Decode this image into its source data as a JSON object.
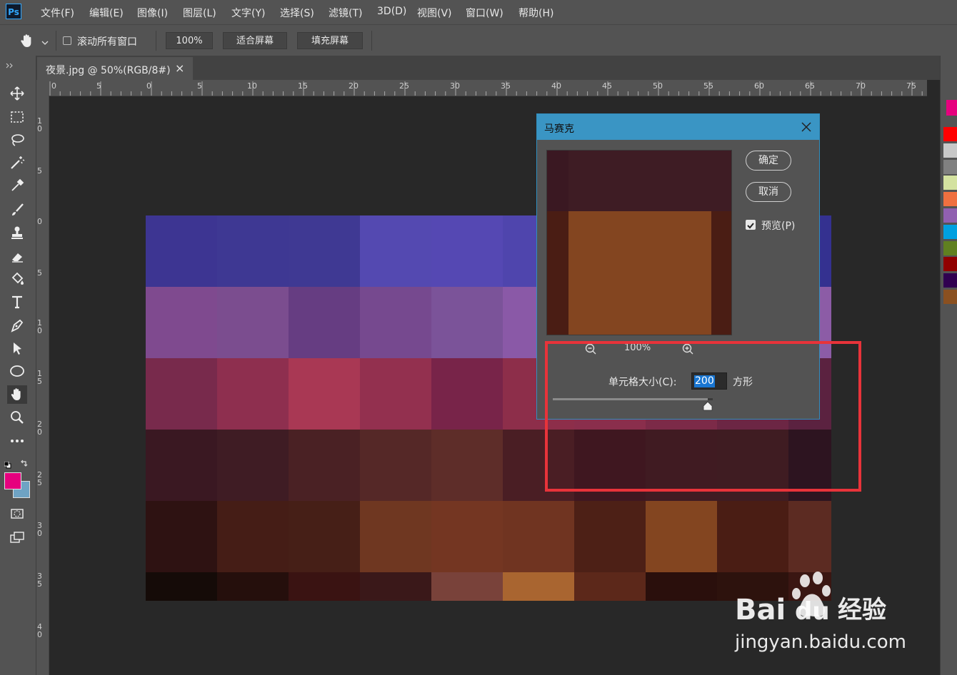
{
  "menu": {
    "logo": "Ps",
    "items": [
      "文件(F)",
      "编辑(E)",
      "图像(I)",
      "图层(L)",
      "文字(Y)",
      "选择(S)",
      "滤镜(T)",
      "3D(D)",
      "视图(V)",
      "窗口(W)",
      "帮助(H)"
    ]
  },
  "options": {
    "scroll_all_label": "滚动所有窗口",
    "zoom_100": "100%",
    "fit_screen": "适合屏幕",
    "fill_screen": "填充屏幕"
  },
  "document": {
    "tab_label": "夜景.jpg @ 50%(RGB/8#)",
    "tab_close": "×"
  },
  "ruler": {
    "h_labels": [
      "0",
      "5",
      "0",
      "5",
      "10",
      "15",
      "20",
      "25",
      "30",
      "35",
      "40",
      "45",
      "50",
      "55",
      "60",
      "65",
      "70",
      "75"
    ],
    "v_labels": [
      "10",
      "5",
      "0",
      "5",
      "10",
      "15",
      "20",
      "25",
      "30",
      "35",
      "40"
    ]
  },
  "colors": {
    "foreground": "#e6007e",
    "background": "#6fa3c4",
    "swatches": [
      "#ff0000",
      "#c8c8c8",
      "#808080",
      "#d4e2a0",
      "#f07040",
      "#9060b0",
      "#00a0e0",
      "#608020",
      "#900000",
      "#300050",
      "#8a5020"
    ],
    "right_top_swatch": "#e6007e"
  },
  "image_grid": [
    [
      "#3d3592",
      "#3e3893",
      "#3f3993",
      "#5449b1",
      "#5548b3",
      "#4f45ad",
      "#4c44ab",
      "#4a42a8",
      "#3f3a9a",
      "#343190"
    ],
    [
      "#7f4a8f",
      "#7b4d8f",
      "#663d82",
      "#76498f",
      "#7b5399",
      "#8a59a7",
      "#8a56a3",
      "#8a58a3",
      "#8d5aa6",
      "#8c5ca6"
    ],
    [
      "#782a4c",
      "#8e2f4f",
      "#a93854",
      "#93304f",
      "#782449",
      "#8d2e4a",
      "#8a2e4c",
      "#7c2a48",
      "#6c2644",
      "#5b2240"
    ],
    [
      "#3a1822",
      "#3f1c24",
      "#4a2124",
      "#552827",
      "#5e2d29",
      "#4a1e24",
      "#3f1720",
      "#401b22",
      "#3f1c22",
      "#2d1420"
    ],
    [
      "#2e1212",
      "#451d16",
      "#461f17",
      "#6f3721",
      "#743622",
      "#703421",
      "#4d2016",
      "#834520",
      "#4a1d14",
      "#5c2b22"
    ],
    [
      "#150b08",
      "#250f0c",
      "#3a1312",
      "#3a1819",
      "#79423a",
      "#a96530",
      "#5c281a",
      "#2a0f0c",
      "#2d120d",
      "#3a1612"
    ]
  ],
  "dialog": {
    "title": "马赛克",
    "ok": "确定",
    "cancel": "取消",
    "preview_label": "预览(P)",
    "zoom": "100%",
    "cell_size_label": "单元格大小(C):",
    "cell_size_value": "200",
    "cell_unit": "方形",
    "slider_fraction": 0.97,
    "preview_colors": {
      "top": "#3e1c24",
      "top_left": "#3a1822",
      "center": "#834520",
      "side": "#4a1d14"
    }
  },
  "watermark": {
    "brand": "Bai du 经验",
    "url": "jingyan.baidu.com"
  }
}
